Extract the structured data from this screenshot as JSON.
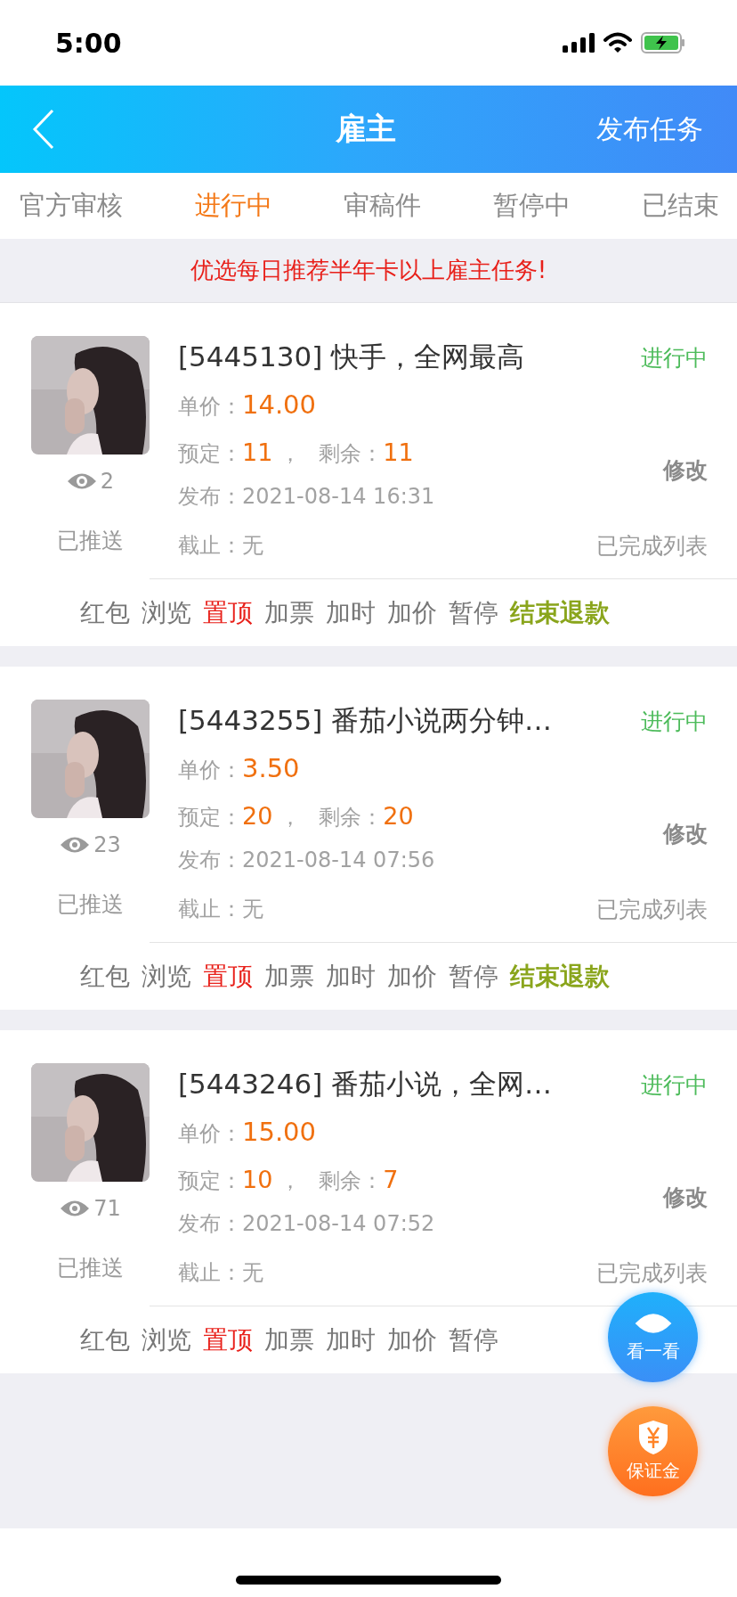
{
  "status_bar": {
    "time": "5:00"
  },
  "header": {
    "title": "雇主",
    "action": "发布任务"
  },
  "tabs": [
    {
      "label": "官方审核",
      "selected": false
    },
    {
      "label": "进行中",
      "selected": true
    },
    {
      "label": "审稿件",
      "selected": false
    },
    {
      "label": "暂停中",
      "selected": false
    },
    {
      "label": "已结束",
      "selected": false
    }
  ],
  "banner": "优选每日推荐半年卡以上雇主任务!",
  "tasks": [
    {
      "avatar": {
        "kind": "picture"
      },
      "views": "2",
      "pushed": "已推送",
      "title": "[5445130] 快手，全网最高",
      "status": "进行中",
      "price_label": "单价：",
      "price": "14.00",
      "booked_label": "预定：",
      "booked": "11",
      "separator": "，",
      "remaining_label": "剩余：",
      "remaining": "11",
      "edit": "修改",
      "published_label": "发布：",
      "published": "2021-08-14 16:31",
      "deadline_label": "截止：",
      "deadline": "无",
      "completed": "已完成列表",
      "actions": [
        {
          "label": "红包",
          "kind": "normal"
        },
        {
          "label": "浏览",
          "kind": "normal"
        },
        {
          "label": "置顶",
          "kind": "highlight"
        },
        {
          "label": "加票",
          "kind": "normal"
        },
        {
          "label": "加时",
          "kind": "normal"
        },
        {
          "label": "加价",
          "kind": "normal"
        },
        {
          "label": "暂停",
          "kind": "normal"
        },
        {
          "label": "结束退款",
          "kind": "end"
        }
      ]
    },
    {
      "avatar": {
        "kind": "picture"
      },
      "views": "23",
      "pushed": "已推送",
      "title": "[5443255] 番茄小说两分钟…",
      "status": "进行中",
      "price_label": "单价：",
      "price": "3.50",
      "booked_label": "预定：",
      "booked": "20",
      "separator": "，",
      "remaining_label": "剩余：",
      "remaining": "20",
      "edit": "修改",
      "published_label": "发布：",
      "published": "2021-08-14 07:56",
      "deadline_label": "截止：",
      "deadline": "无",
      "completed": "已完成列表",
      "actions": [
        {
          "label": "红包",
          "kind": "normal"
        },
        {
          "label": "浏览",
          "kind": "normal"
        },
        {
          "label": "置顶",
          "kind": "highlight"
        },
        {
          "label": "加票",
          "kind": "normal"
        },
        {
          "label": "加时",
          "kind": "normal"
        },
        {
          "label": "加价",
          "kind": "normal"
        },
        {
          "label": "暂停",
          "kind": "normal"
        },
        {
          "label": "结束退款",
          "kind": "end"
        }
      ]
    },
    {
      "avatar": {
        "kind": "picture"
      },
      "views": "71",
      "pushed": "已推送",
      "title": "[5443246] 番茄小说，全网…",
      "status": "进行中",
      "price_label": "单价：",
      "price": "15.00",
      "booked_label": "预定：",
      "booked": "10",
      "separator": "，",
      "remaining_label": "剩余：",
      "remaining": "7",
      "edit": "修改",
      "published_label": "发布：",
      "published": "2021-08-14 07:52",
      "deadline_label": "截止：",
      "deadline": "无",
      "completed": "已完成列表",
      "actions": [
        {
          "label": "红包",
          "kind": "normal"
        },
        {
          "label": "浏览",
          "kind": "normal"
        },
        {
          "label": "置顶",
          "kind": "highlight"
        },
        {
          "label": "加票",
          "kind": "normal"
        },
        {
          "label": "加时",
          "kind": "normal"
        },
        {
          "label": "加价",
          "kind": "normal"
        },
        {
          "label": "暂停",
          "kind": "normal"
        }
      ]
    }
  ],
  "floating_buttons": [
    {
      "label": "看一看",
      "kind": "eye"
    },
    {
      "label": "保证金",
      "kind": "shield"
    }
  ]
}
